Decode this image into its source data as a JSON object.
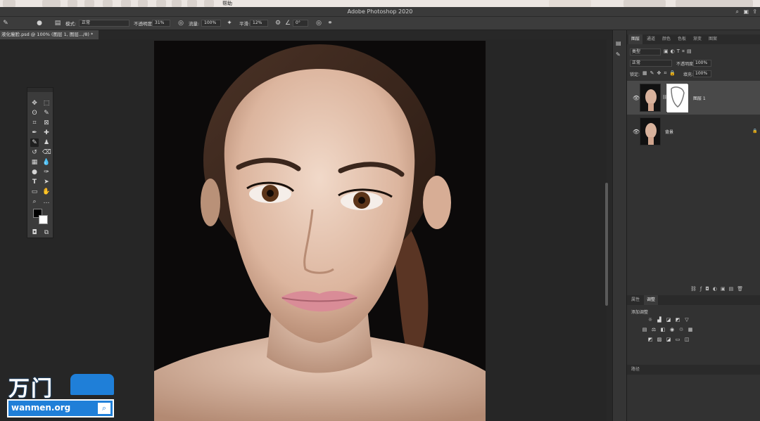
{
  "menubar": {
    "items": [
      "帮助"
    ]
  },
  "window": {
    "title": "Adobe Photoshop 2020"
  },
  "options": {
    "mode_label": "模式:",
    "mode_value": "正常",
    "opacity_label": "不透明度:",
    "opacity_value": "31%",
    "flow_label": "流量:",
    "flow_value": "100%",
    "smoothing_label": "平滑:",
    "smoothing_value": "12%",
    "angle_value": "0°"
  },
  "document": {
    "tab": "液化瘦脸.psd @ 100% (图层 1, 图层.../8) *"
  },
  "panels": {
    "layers_tabs": [
      "图层",
      "通道",
      "颜色",
      "色板",
      "渐变",
      "图案"
    ],
    "filter_kind": "类型",
    "blend_mode": "正常",
    "opacity_label": "不透明度:",
    "opacity_value": "100%",
    "lock_label": "锁定:",
    "fill_label": "填充:",
    "fill_value": "100%",
    "layers": [
      {
        "name": "图层 1",
        "selected": true
      },
      {
        "name": "背景",
        "selected": false
      }
    ],
    "props_tabs": [
      "属性",
      "调整"
    ],
    "adjust_title": "添加调整",
    "paths_tab": "路径"
  },
  "icons": {
    "eye": "eye-icon",
    "lock": "lock-icon",
    "search": "search-icon"
  },
  "watermark": {
    "brand": "万门",
    "url": "wanmen.org"
  },
  "colors": {
    "accent": "#1f7fd8",
    "panel": "#323232",
    "canvas": "#262626"
  }
}
